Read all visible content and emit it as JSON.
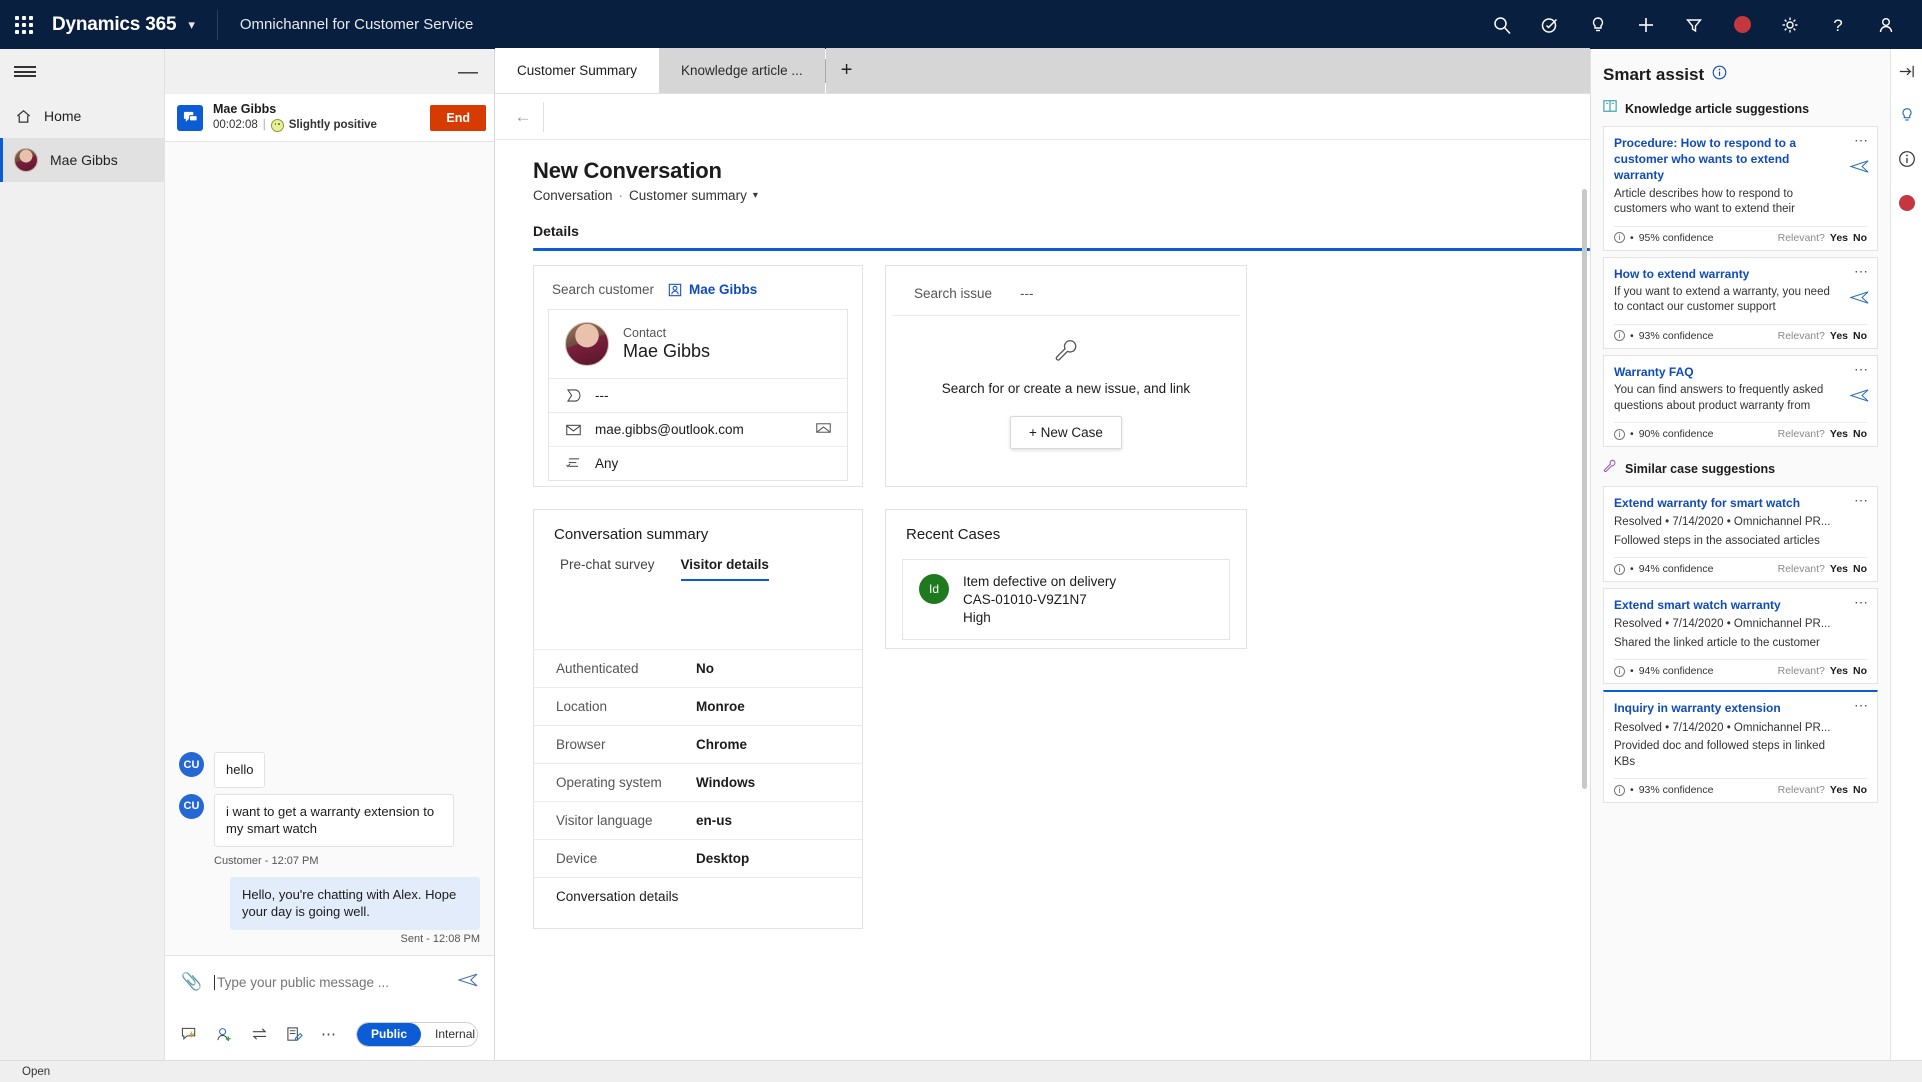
{
  "topnav": {
    "brand": "Dynamics 365",
    "app_name": "Omnichannel for Customer Service",
    "icons": [
      "search-icon",
      "assistant-icon",
      "insights-icon",
      "add-icon",
      "filter-icon",
      "presence-dot",
      "settings-icon",
      "help-icon",
      "user-icon"
    ]
  },
  "leftrail": {
    "items": [
      {
        "label": "Home",
        "icon": "home-icon"
      },
      {
        "label": "Mae Gibbs",
        "icon": "avatar"
      }
    ]
  },
  "conversation": {
    "minimize": "—",
    "customer_name": "Mae Gibbs",
    "timer": "00:02:08",
    "sentiment": "Slightly positive",
    "end_button": "End",
    "messages": [
      {
        "author": "CU",
        "direction": "in",
        "text": "hello"
      },
      {
        "author": "CU",
        "direction": "in",
        "text": "i want to get a warranty extension to my smart watch",
        "stamp": "Customer - 12:07 PM"
      },
      {
        "direction": "out",
        "text": "Hello, you're chatting with Alex. Hope your day is going well.",
        "stamp": "Sent - 12:08 PM"
      }
    ],
    "composer": {
      "placeholder": "Type your public message ...",
      "value": "",
      "tools": [
        "quick-reply-icon",
        "add-agent-icon",
        "transfer-icon",
        "notes-icon",
        "more-icon"
      ],
      "modes": [
        {
          "label": "Public",
          "active": true
        },
        {
          "label": "Internal",
          "active": false
        }
      ]
    }
  },
  "main": {
    "tabs": [
      {
        "label": "Customer Summary",
        "active": true
      },
      {
        "label": "Knowledge article ...",
        "active": false
      }
    ],
    "add_tab": "+",
    "page_title": "New Conversation",
    "breadcrumb": {
      "entity": "Conversation",
      "sep": "·",
      "view": "Customer summary",
      "chevron": "⌄"
    },
    "detail_tab": "Details",
    "customer_card": {
      "search_label": "Search customer",
      "chip": "Mae Gibbs",
      "contact_label": "Contact",
      "contact_name": "Mae Gibbs",
      "fields": [
        {
          "icon": "tag-icon",
          "value": "---",
          "trail": ""
        },
        {
          "icon": "mail-icon",
          "value": "mae.gibbs@outlook.com",
          "trail": "email-action-icon"
        },
        {
          "icon": "list-icon",
          "value": "Any",
          "trail": ""
        }
      ]
    },
    "issue_card": {
      "search_label": "Search issue",
      "search_value": "---",
      "hint": "Search for or create a new issue, and link",
      "new_case_button": "+ New Case"
    },
    "summary_card": {
      "title": "Conversation summary",
      "subtabs": [
        {
          "label": "Pre-chat survey",
          "active": false
        },
        {
          "label": "Visitor details",
          "active": true
        }
      ],
      "rows": [
        {
          "key": "Authenticated",
          "value": "No"
        },
        {
          "key": "Location",
          "value": "Monroe"
        },
        {
          "key": "Browser",
          "value": "Chrome"
        },
        {
          "key": "Operating system",
          "value": "Windows"
        },
        {
          "key": "Visitor language",
          "value": "en-us"
        },
        {
          "key": "Device",
          "value": "Desktop"
        },
        {
          "key": "Conversation details",
          "value": ""
        }
      ]
    },
    "cases_card": {
      "title": "Recent Cases",
      "items": [
        {
          "badge": "Id",
          "title": "Item defective on delivery",
          "number": "CAS-01010-V9Z1N7",
          "priority": "High"
        }
      ]
    },
    "status": "Open"
  },
  "smart_assist": {
    "title": "Smart assist",
    "sections": [
      {
        "icon": "knowledge-icon",
        "label": "Knowledge article suggestions"
      },
      {
        "icon": "similar-case-icon",
        "label": "Similar case suggestions"
      }
    ],
    "relevant_label": "Relevant?",
    "yes_label": "Yes",
    "no_label": "No",
    "knowledge_cards": [
      {
        "title": "Procedure: How to respond to a customer who wants to extend warranty",
        "desc": "Article describes how to respond to customers who want to extend their",
        "confidence": "95% confidence"
      },
      {
        "title": "How to extend warranty",
        "desc": "If you want to extend a warranty, you need to contact our customer support",
        "confidence": "93% confidence"
      },
      {
        "title": "Warranty FAQ",
        "desc": "You can find answers to frequently asked questions about product warranty from",
        "confidence": "90% confidence"
      }
    ],
    "case_cards": [
      {
        "title": "Extend warranty for smart watch",
        "sub": "Resolved • 7/14/2020 • Omnichannel PR...",
        "desc": "Followed steps in the associated articles",
        "confidence": "94% confidence",
        "focused": false
      },
      {
        "title": "Extend smart watch warranty",
        "sub": "Resolved • 7/14/2020 • Omnichannel PR...",
        "desc": "Shared the linked article to the customer",
        "confidence": "94% confidence",
        "focused": false
      },
      {
        "title": "Inquiry in warranty extension",
        "sub": "Resolved • 7/14/2020 • Omnichannel PR...",
        "desc": "Provided doc and followed steps in linked KBs",
        "confidence": "93% confidence",
        "focused": true
      }
    ]
  },
  "farrail": {
    "icons": [
      "expand-icon",
      "lightbulb-icon",
      "info-icon",
      "presence-dot"
    ]
  }
}
